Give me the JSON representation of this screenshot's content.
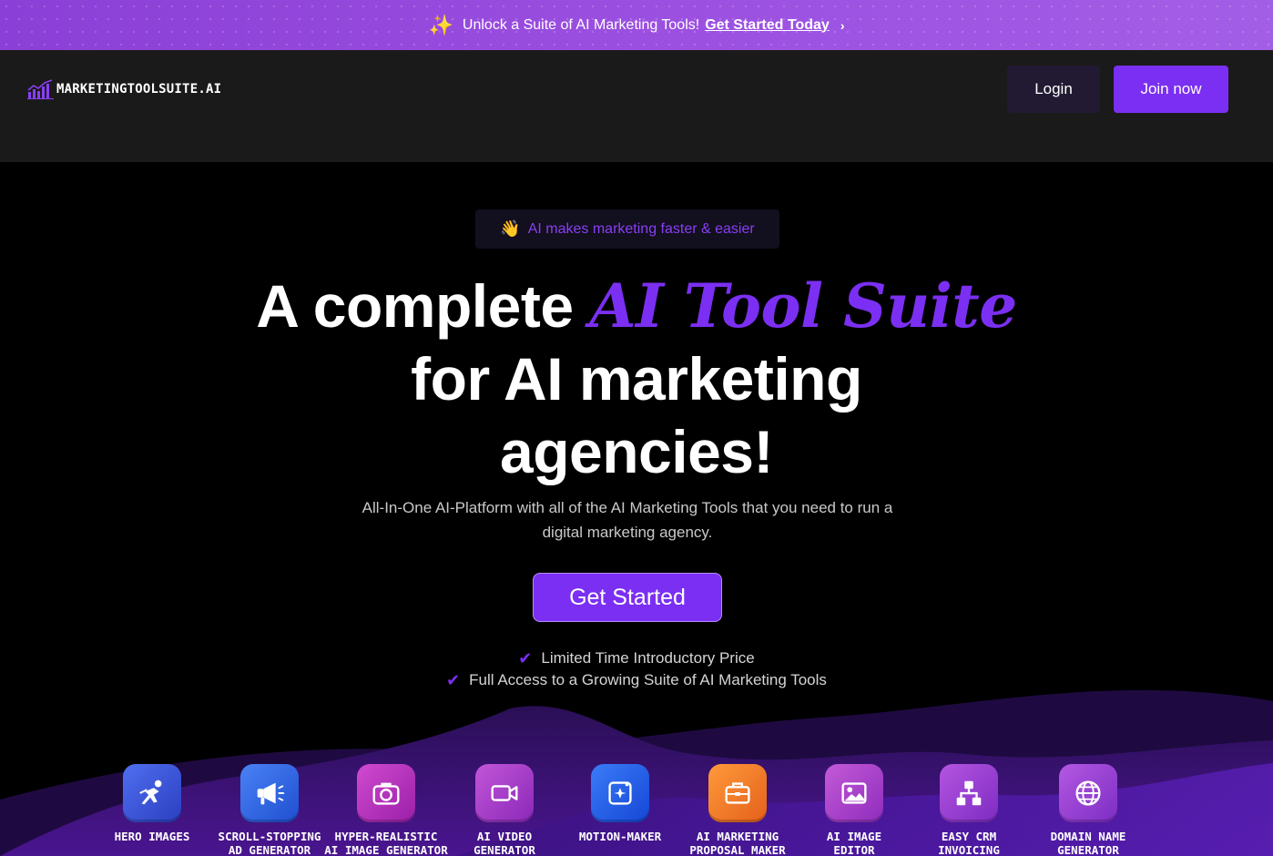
{
  "banner": {
    "sparkle_icon": "sparkles-icon",
    "text": "Unlock a Suite of AI Marketing Tools!",
    "link": "Get Started Today",
    "chevron_icon": "chevron-right-icon",
    "colors": {
      "from": "#8a3fd6",
      "to": "#a35ee6"
    }
  },
  "header": {
    "logo_text": "MARKETINGTOOLSUITE.AI",
    "logo_icon": "bar-chart-icon",
    "login_label": "Login",
    "join_label": "Join now",
    "colors": {
      "accent": "#7b2ff2",
      "background": "#1a1a1a"
    }
  },
  "hero": {
    "pill_emoji": "👋",
    "pill_text": "AI makes marketing faster & easier",
    "headline_pre": "A complete ",
    "headline_accent": "AI Tool Suite",
    "headline_line2": "for AI marketing",
    "headline_line3": "agencies!",
    "subtext": "All-In-One AI-Platform with all of the AI Marketing Tools that you need to run a digital marketing agency.",
    "cta_label": "Get Started",
    "checks": [
      "Limited Time Introductory Price",
      "Full Access to a Growing Suite of AI Marketing Tools"
    ]
  },
  "tools": [
    {
      "label": "HERO IMAGES",
      "icon": "superhero-icon",
      "color": "#3a5bd9"
    },
    {
      "label": "SCROLL-STOPPING\nAD GENERATOR",
      "icon": "megaphone-icon",
      "color": "#2f67e0"
    },
    {
      "label": "HYPER-REALISTIC\nAI IMAGE GENERATOR",
      "icon": "camera-icon",
      "color": "#b02fb8"
    },
    {
      "label": "AI VIDEO\nGENERATOR",
      "icon": "video-camera-icon",
      "color": "#a43bc4"
    },
    {
      "label": "MOTION-MAKER",
      "icon": "motion-frame-icon",
      "color": "#1f5fe8"
    },
    {
      "label": "AI MARKETING\nPROPOSAL MAKER",
      "icon": "briefcase-icon",
      "color": "#f07a2a"
    },
    {
      "label": "AI IMAGE\nEDITOR",
      "icon": "image-icon",
      "color": "#a83dc6"
    },
    {
      "label": "EASY CRM\nINVOICING",
      "icon": "hierarchy-icon",
      "color": "#9b3fd0"
    },
    {
      "label": "DOMAIN NAME\nGENERATOR",
      "icon": "globe-icon",
      "color": "#9a3fd2"
    }
  ]
}
